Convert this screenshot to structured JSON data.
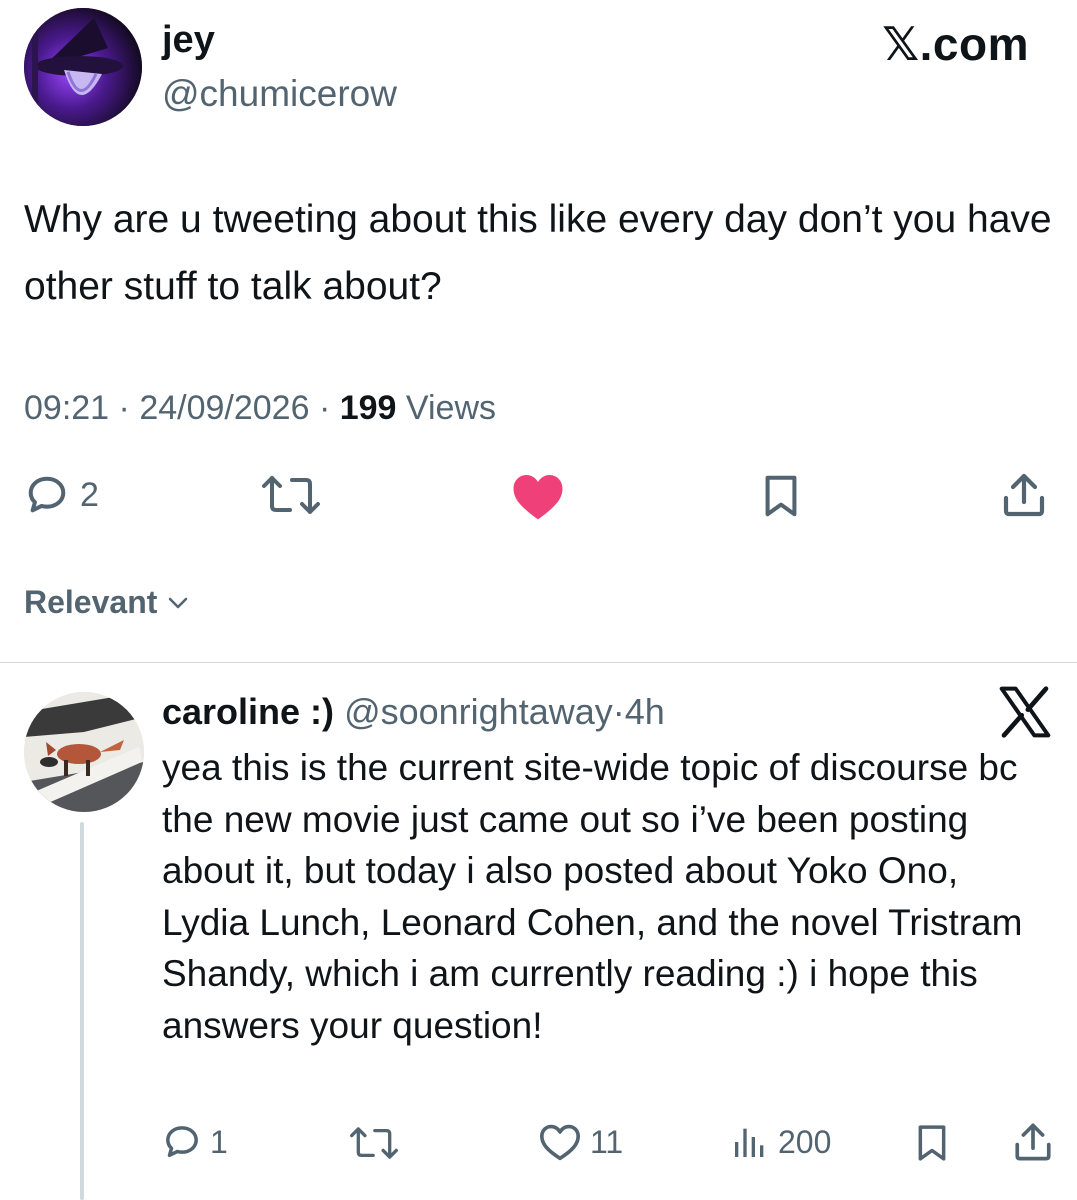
{
  "header": {
    "site_logo": "𝕏.com"
  },
  "tweet": {
    "author": {
      "display_name": "jey",
      "handle": "@chumicerow"
    },
    "text": "Why are u tweeting about this like every day don’t you have other stuff to talk about?",
    "time": "09:21",
    "date": "24/09/2026",
    "separator": "·",
    "views_count": "199",
    "views_label": "Views",
    "actions": {
      "reply_count": "2",
      "liked": true,
      "like_color": "#f0407a"
    }
  },
  "replies_sort": {
    "label": "Relevant"
  },
  "reply": {
    "display_name": "caroline :)",
    "handle": "@soonrightaway",
    "separator": "·",
    "time": "4h",
    "text": "yea this is the current site-wide topic of discourse bc the new movie just came out so i’ve been posting about it, but today i also posted about Yoko Ono, Lydia Lunch, Leonard Cohen, and the novel Tristram Shandy, which i am currently reading :) i hope this answers your question!",
    "actions": {
      "reply_count": "1",
      "like_count": "11",
      "views_count": "200"
    }
  },
  "colors": {
    "text_primary": "#0f1419",
    "text_secondary": "#536471",
    "divider": "#cfd9de",
    "like": "#f0407a"
  },
  "icons": [
    "x-logo",
    "reply-icon",
    "retweet-icon",
    "heart-icon",
    "bookmark-icon",
    "share-icon",
    "views-icon",
    "chevron-down-icon"
  ]
}
